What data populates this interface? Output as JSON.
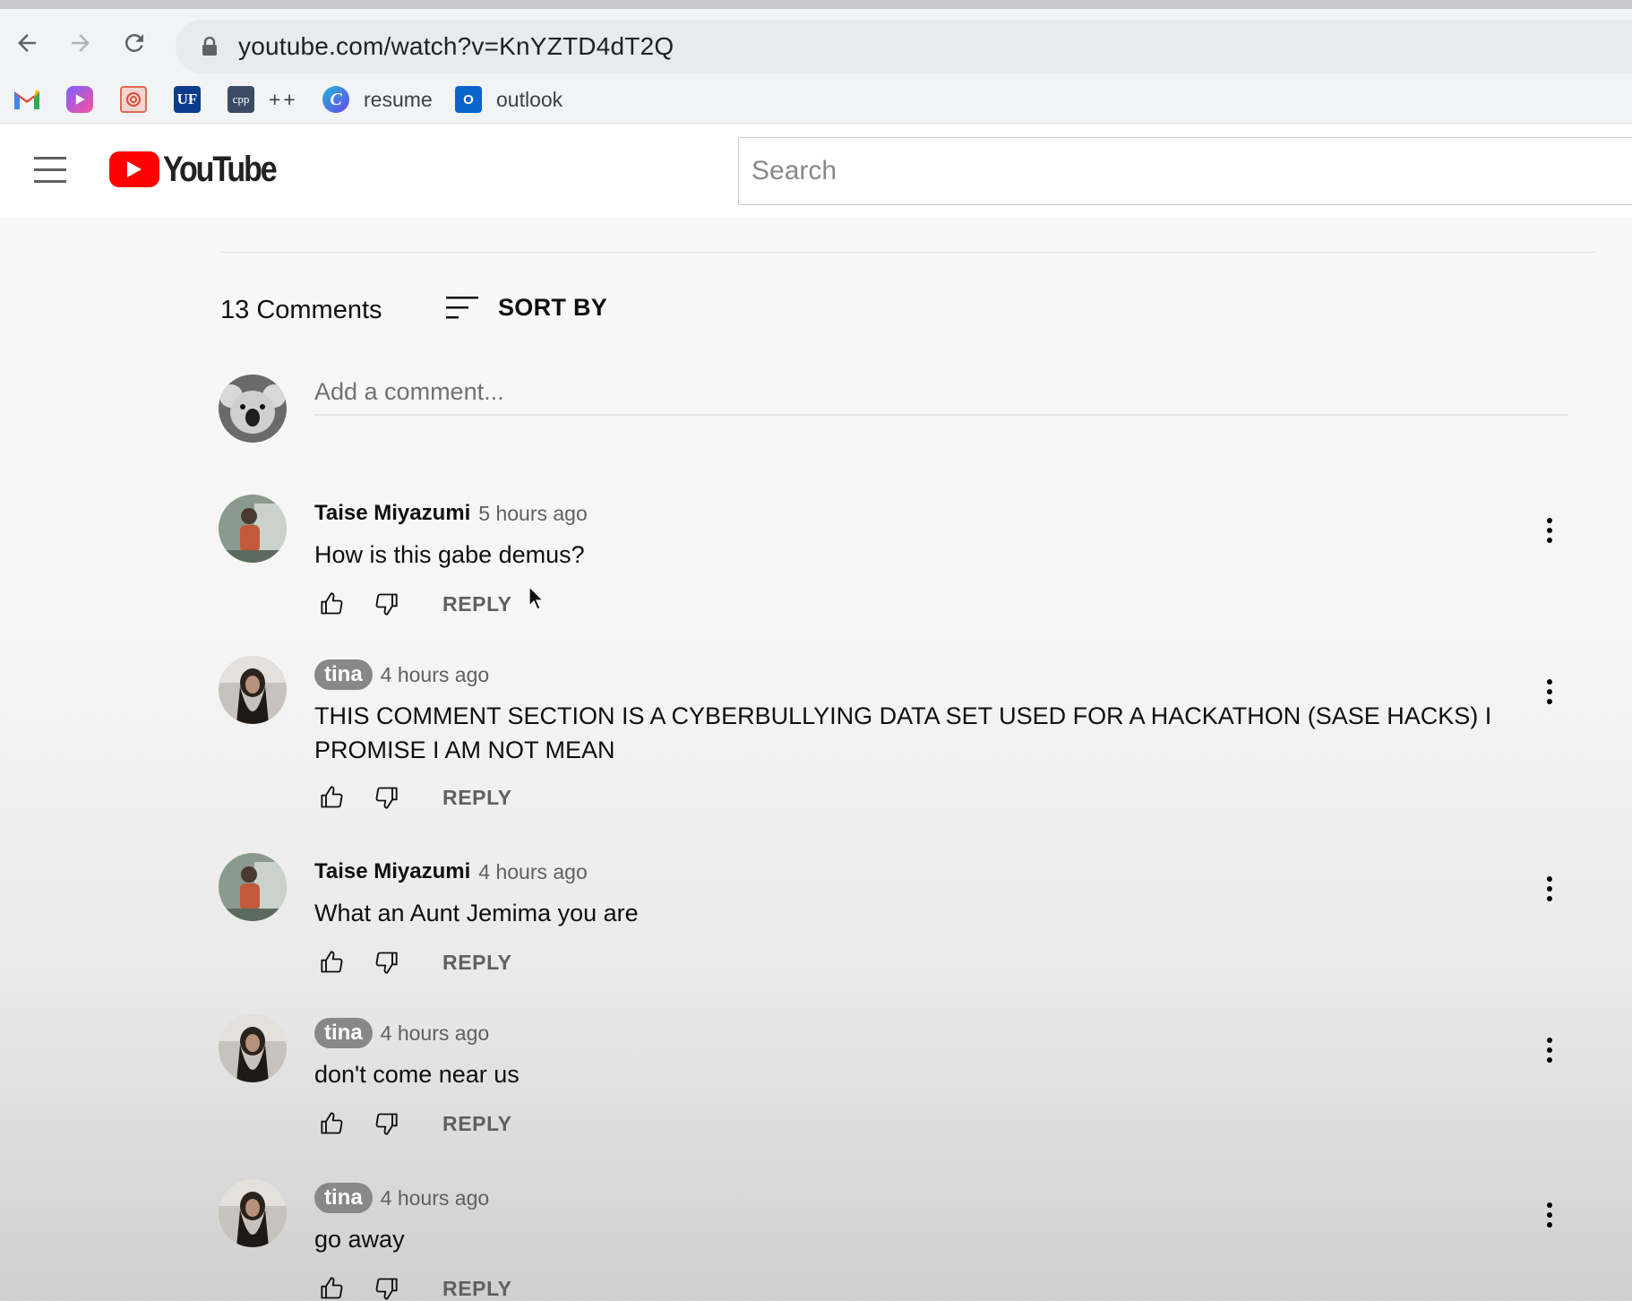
{
  "browser": {
    "url": "youtube.com/watch?v=KnYZTD4dT2Q",
    "bookmarks": [
      {
        "name": "gmail",
        "label": "",
        "icon": "gmail-icon"
      },
      {
        "name": "app",
        "label": "",
        "icon": "app-icon"
      },
      {
        "name": "openai",
        "label": "",
        "icon": "openai-icon"
      },
      {
        "name": "uf",
        "label": "UF",
        "icon": "uf-icon"
      },
      {
        "name": "cpp",
        "label": "cpp",
        "icon": "cpp-icon"
      },
      {
        "name": "plusplus",
        "label": "++",
        "icon": ""
      },
      {
        "name": "resume",
        "label": "resume",
        "icon": "canva-icon"
      },
      {
        "name": "outlook",
        "label": "outlook",
        "icon": "outlook-icon"
      }
    ]
  },
  "youtube": {
    "logo_text": "YouTube",
    "search_placeholder": "Search"
  },
  "comments_header": {
    "count_text": "13 Comments",
    "sort_label": "SORT BY"
  },
  "add_comment": {
    "placeholder": "Add a comment..."
  },
  "reply_label": "REPLY",
  "comments": [
    {
      "author": "Taise Miyazumi",
      "time": "5 hours ago",
      "text": "How is this gabe demus?",
      "pill": false
    },
    {
      "author": "tina",
      "time": "4 hours ago",
      "text": "THIS COMMENT SECTION IS A CYBERBULLYING DATA SET USED FOR A HACKATHON (SASE HACKS) I PROMISE I AM NOT MEAN",
      "pill": true
    },
    {
      "author": "Taise Miyazumi",
      "time": "4 hours ago",
      "text": "What an Aunt Jemima you are",
      "pill": false
    },
    {
      "author": "tina",
      "time": "4 hours ago",
      "text": "don't come near us",
      "pill": true
    },
    {
      "author": "tina",
      "time": "4 hours ago",
      "text": "go away",
      "pill": true
    }
  ],
  "colors": {
    "youtube_red": "#ff0000",
    "pill_gray": "#888888",
    "secondary_text": "#606060"
  }
}
